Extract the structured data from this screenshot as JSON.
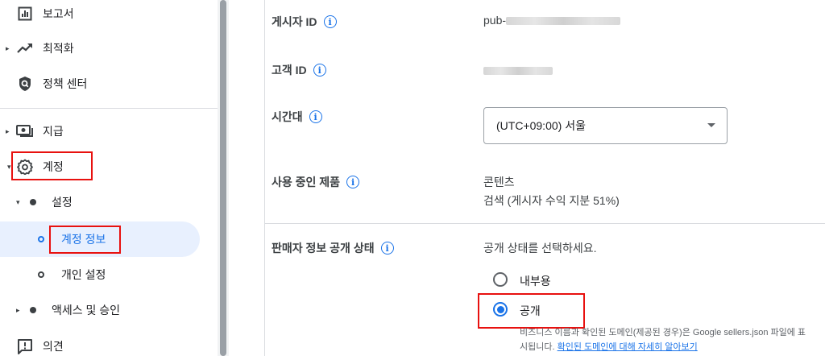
{
  "sidebar": {
    "items": [
      {
        "label": "보고서",
        "icon": "bar-chart-icon"
      },
      {
        "label": "최적화",
        "icon": "trending-up-icon"
      },
      {
        "label": "정책 센터",
        "icon": "policy-shield-icon"
      },
      {
        "label": "지급",
        "icon": "payments-icon"
      },
      {
        "label": "계정",
        "icon": "gear-icon"
      },
      {
        "label": "설정"
      },
      {
        "label": "계정 정보"
      },
      {
        "label": "개인 설정"
      },
      {
        "label": "액세스 및 승인"
      },
      {
        "label": "의견",
        "icon": "feedback-icon"
      }
    ]
  },
  "main": {
    "publisher_id": {
      "label": "게시자 ID",
      "value_prefix": "pub-"
    },
    "customer_id": {
      "label": "고객 ID"
    },
    "timezone": {
      "label": "시간대",
      "value": "(UTC+09:00) 서울"
    },
    "products": {
      "label": "사용 중인 제품",
      "line1": "콘텐츠",
      "line2": "검색 (게시자 수익 지분 51%)"
    },
    "seller_info": {
      "label": "판매자 정보 공개 상태",
      "prompt": "공개 상태를 선택하세요.",
      "options": [
        {
          "label": "내부용",
          "checked": false
        },
        {
          "label": "공개",
          "checked": true
        }
      ],
      "helper_line1": "비즈니스 이름과 확인된 도메인(제공된 경우)은 Google sellers.json 파일에 표",
      "helper_line2_prefix": "시됩니다. ",
      "helper_link": "확인된 도메인에 대해 자세히 알아보기"
    }
  },
  "colors": {
    "accent": "#1a73e8",
    "highlight_box": "#e8110f",
    "selected_bg": "#e8f0fe"
  }
}
